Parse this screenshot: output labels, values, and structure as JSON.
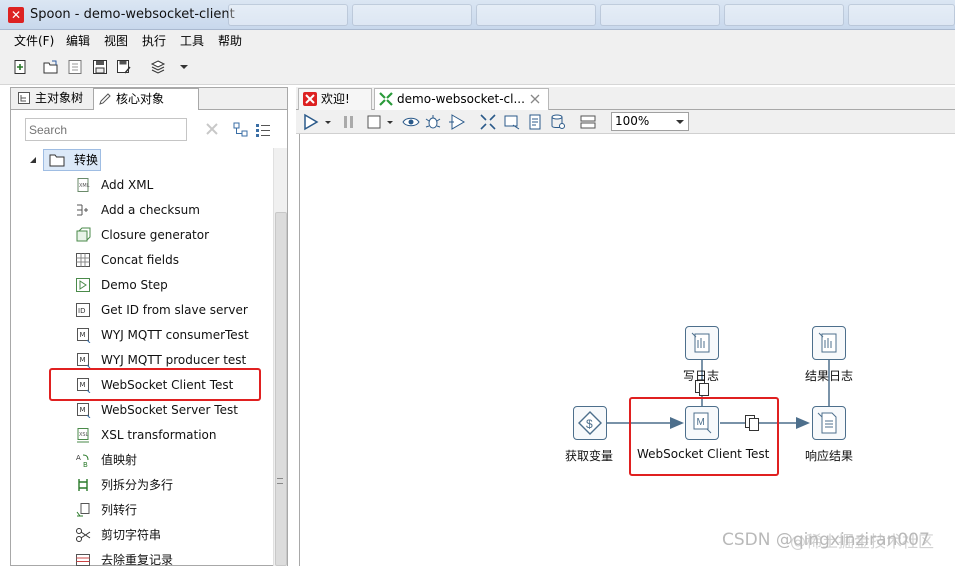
{
  "window": {
    "title": "Spoon - demo-websocket-client"
  },
  "menu": [
    "文件(F)",
    "编辑",
    "视图",
    "执行",
    "工具",
    "帮助"
  ],
  "left_panel": {
    "tabs": [
      "主对象树",
      "核心对象"
    ],
    "search": {
      "placeholder": "Search"
    },
    "folder": "转换",
    "items": [
      "Add XML",
      "Add a checksum",
      "Closure generator",
      "Concat fields",
      "Demo Step",
      "Get ID from slave server",
      "WYJ MQTT consumerTest",
      "WYJ MQTT producer test",
      "WebSocket Client Test",
      "WebSocket Server Test",
      "XSL transformation",
      "值映射",
      "列拆分为多行",
      "列转行",
      "剪切字符串",
      "去除重复记录"
    ]
  },
  "editor": {
    "tabs": [
      "欢迎!",
      "demo-websocket-cl..."
    ],
    "zoom": "100%"
  },
  "canvas": {
    "steps": {
      "get_vars": "获取变量",
      "ws_client": "WebSocket Client Test",
      "write_log": "写日志",
      "response": "响应结果",
      "result_log": "结果日志"
    }
  },
  "watermark": "CSDN @qingxinziran007",
  "watermark2": "@稀土掘金技术社区",
  "colors": {
    "highlight": "#e02020",
    "step_border": "#4d6f8c",
    "hop": "#4d6f8c"
  }
}
